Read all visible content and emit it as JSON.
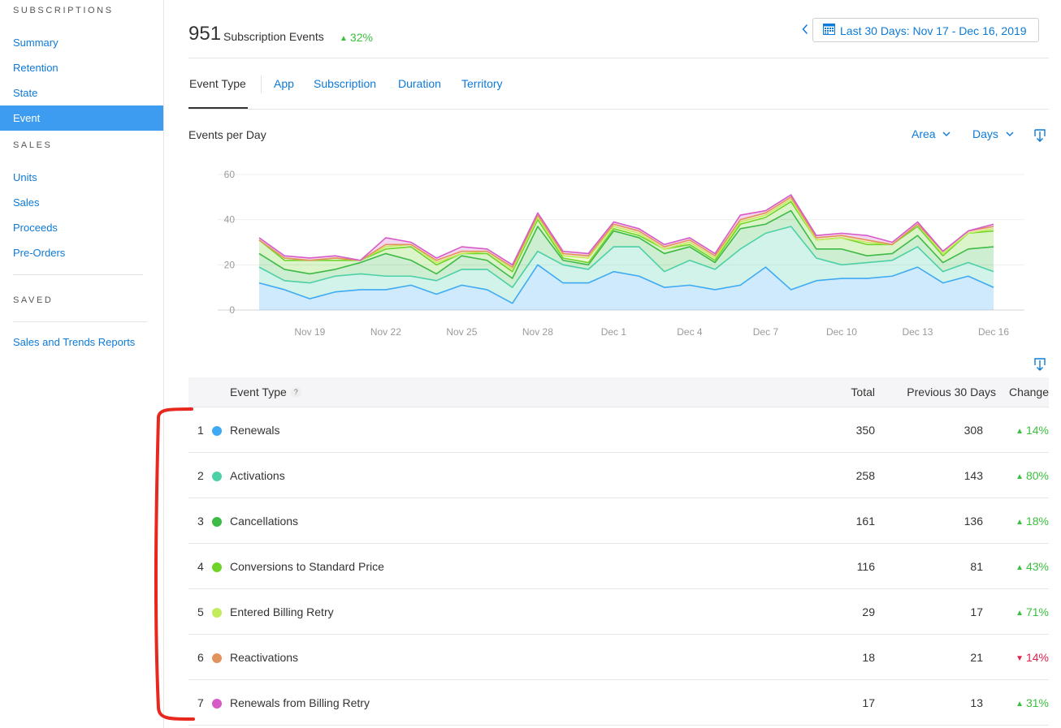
{
  "sidebar": {
    "sections": [
      {
        "heading": "SUBSCRIPTIONS",
        "items": [
          "Summary",
          "Retention",
          "State",
          "Event"
        ]
      },
      {
        "heading": "SALES",
        "items": [
          "Units",
          "Sales",
          "Proceeds",
          "Pre-Orders"
        ]
      },
      {
        "heading": "SAVED",
        "items": [
          "Sales and Trends Reports"
        ]
      }
    ],
    "active_item": "Event"
  },
  "header": {
    "count": "951",
    "label": "Subscription Events",
    "change": "32%",
    "prev_icon": "chevron-left-icon",
    "date_range": "Last 30 Days: Nov 17 - Dec 16, 2019",
    "date_icon": "calendar-icon"
  },
  "tabs": [
    "Event Type",
    "App",
    "Subscription",
    "Duration",
    "Territory"
  ],
  "chart_header": {
    "title": "Events per Day",
    "chart_type_select": "Area",
    "granularity_select": "Days",
    "download_icon": "download-icon"
  },
  "chart_data": {
    "type": "area",
    "stacked": true,
    "ylim": [
      0,
      60
    ],
    "yticks": [
      0,
      20,
      40,
      60
    ],
    "grid": true,
    "x": [
      "Nov 17",
      "Nov 18",
      "Nov 19",
      "Nov 20",
      "Nov 21",
      "Nov 22",
      "Nov 23",
      "Nov 24",
      "Nov 25",
      "Nov 26",
      "Nov 27",
      "Nov 28",
      "Nov 29",
      "Nov 30",
      "Dec 1",
      "Dec 2",
      "Dec 3",
      "Dec 4",
      "Dec 5",
      "Dec 6",
      "Dec 7",
      "Dec 8",
      "Dec 9",
      "Dec 10",
      "Dec 11",
      "Dec 12",
      "Dec 13",
      "Dec 14",
      "Dec 15",
      "Dec 16"
    ],
    "xtick_labels": [
      "Nov 19",
      "Nov 22",
      "Nov 25",
      "Nov 28",
      "Dec 1",
      "Dec 4",
      "Dec 7",
      "Dec 10",
      "Dec 13",
      "Dec 16"
    ],
    "series": [
      {
        "name": "Renewals",
        "color": "#3eaaf3",
        "values": [
          12,
          9,
          5,
          8,
          9,
          9,
          11,
          7,
          11,
          9,
          3,
          20,
          12,
          12,
          17,
          15,
          10,
          11,
          9,
          11,
          19,
          9,
          13,
          14,
          14,
          15,
          19,
          12,
          15,
          10
        ]
      },
      {
        "name": "Activations",
        "color": "#4cd0a6",
        "values": [
          7,
          4,
          7,
          7,
          7,
          6,
          4,
          6,
          7,
          9,
          7,
          6,
          8,
          6,
          11,
          13,
          7,
          11,
          9,
          16,
          15,
          28,
          10,
          6,
          7,
          7,
          9,
          5,
          6,
          7
        ]
      },
      {
        "name": "Cancellations",
        "color": "#3dbb46",
        "values": [
          6,
          5,
          4,
          3,
          5,
          10,
          7,
          3,
          6,
          4,
          4,
          11,
          2,
          2,
          7,
          4,
          8,
          6,
          3,
          9,
          4,
          7,
          4,
          7,
          3,
          3,
          5,
          4,
          6,
          11
        ]
      },
      {
        "name": "Conversions to Standard Price",
        "color": "#6fd32a",
        "values": [
          6,
          4,
          6,
          4,
          1,
          2,
          6,
          4,
          1,
          3,
          3,
          3,
          1,
          1,
          1,
          1,
          2,
          1,
          1,
          2,
          3,
          4,
          4,
          5,
          5,
          4,
          4,
          3,
          7,
          7
        ]
      },
      {
        "name": "Entered Billing Retry",
        "color": "#c2ec5c",
        "values": [
          0,
          1,
          0,
          1,
          0,
          1,
          1,
          1,
          0,
          1,
          1,
          1,
          1,
          2,
          1,
          1,
          0,
          1,
          1,
          1,
          1,
          1,
          0,
          0,
          1,
          0,
          1,
          1,
          0,
          1
        ]
      },
      {
        "name": "Reactivations",
        "color": "#e2935b",
        "values": [
          0,
          0,
          0,
          0,
          0,
          1,
          0,
          1,
          1,
          0,
          1,
          1,
          1,
          1,
          1,
          1,
          1,
          1,
          1,
          1,
          1,
          1,
          1,
          1,
          1,
          0,
          0,
          1,
          1,
          1
        ]
      },
      {
        "name": "Renewals from Billing Retry",
        "color": "#d65bc7",
        "values": [
          1,
          1,
          1,
          1,
          0,
          3,
          1,
          1,
          2,
          1,
          1,
          1,
          1,
          1,
          1,
          1,
          1,
          1,
          1,
          2,
          1,
          1,
          1,
          1,
          2,
          1,
          1,
          0,
          0,
          1
        ]
      }
    ]
  },
  "table": {
    "download_icon": "download-icon",
    "headers": {
      "event_type": "Event Type",
      "help": "?",
      "total": "Total",
      "previous": "Previous 30 Days",
      "change": "Change"
    },
    "rows": [
      {
        "rank": "1",
        "name": "Renewals",
        "color": "#3eaaf3",
        "total": "350",
        "previous": "308",
        "change": "14%",
        "direction": "up"
      },
      {
        "rank": "2",
        "name": "Activations",
        "color": "#4cd0a6",
        "total": "258",
        "previous": "143",
        "change": "80%",
        "direction": "up"
      },
      {
        "rank": "3",
        "name": "Cancellations",
        "color": "#3dbb46",
        "total": "161",
        "previous": "136",
        "change": "18%",
        "direction": "up"
      },
      {
        "rank": "4",
        "name": "Conversions to Standard Price",
        "color": "#6fd32a",
        "total": "116",
        "previous": "81",
        "change": "43%",
        "direction": "up"
      },
      {
        "rank": "5",
        "name": "Entered Billing Retry",
        "color": "#c2ec5c",
        "total": "29",
        "previous": "17",
        "change": "71%",
        "direction": "up"
      },
      {
        "rank": "6",
        "name": "Reactivations",
        "color": "#e2935b",
        "total": "18",
        "previous": "21",
        "change": "14%",
        "direction": "down"
      },
      {
        "rank": "7",
        "name": "Renewals from Billing Retry",
        "color": "#d65bc7",
        "total": "17",
        "previous": "13",
        "change": "31%",
        "direction": "up"
      }
    ]
  },
  "annotation": {
    "bracket_color": "#e8281e"
  }
}
